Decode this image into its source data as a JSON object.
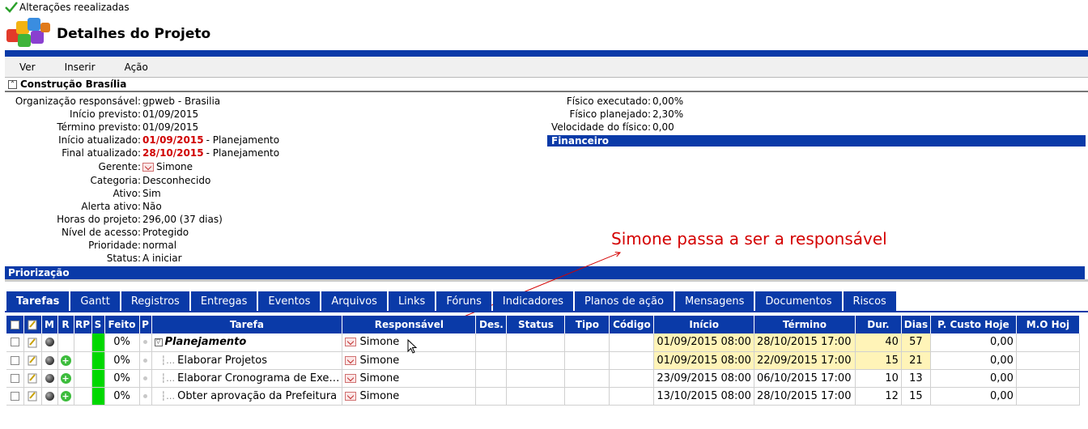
{
  "status": {
    "message": "Alterações reealizadas",
    "icon": "check-icon"
  },
  "header": {
    "title": "Detalhes do Projeto",
    "logo": "puzzle-logo"
  },
  "menu": [
    "Ver",
    "Inserir",
    "Ação"
  ],
  "project": {
    "name": "Construção Brasília",
    "left": [
      {
        "label": "Organização responsável:",
        "value": "gpweb - Brasilia"
      },
      {
        "label": "Início previsto:",
        "value": "01/09/2015"
      },
      {
        "label": "Término previsto:",
        "value": "01/09/2015"
      },
      {
        "label": "Início atualizado:",
        "value": "01/09/2015",
        "suffix": " - Planejamento"
      },
      {
        "label": "Final atualizado:",
        "value": "28/10/2015",
        "suffix": " - Planejamento"
      },
      {
        "label": "Gerente:",
        "value": "Simone"
      },
      {
        "label": "Categoria:",
        "value": "Desconhecido"
      },
      {
        "label": "Ativo:",
        "value": "Sim"
      },
      {
        "label": "Alerta ativo:",
        "value": "Não"
      },
      {
        "label": "Horas do projeto:",
        "value": "296,00 (37 dias)"
      },
      {
        "label": "Nível de acesso:",
        "value": "Protegido"
      },
      {
        "label": "Prioridade:",
        "value": "normal"
      },
      {
        "label": "Status:",
        "value": "A iniciar"
      }
    ],
    "right": [
      {
        "label": "Físico executado:",
        "value": "0,00%"
      },
      {
        "label": "Físico planejado:",
        "value": "2,30%"
      },
      {
        "label": "Velocidade do físico:",
        "value": "0,00"
      }
    ],
    "financeiro": "Financeiro",
    "priorizacao": "Priorização"
  },
  "annotation": "Simone passa a ser a responsável",
  "tabs": [
    "Tarefas",
    "Gantt",
    "Registros",
    "Entregas",
    "Eventos",
    "Arquivos",
    "Links",
    "Fóruns",
    "Indicadores",
    "Planos de ação",
    "Mensagens",
    "Documentos",
    "Riscos"
  ],
  "table": {
    "headers": [
      "",
      "",
      "M",
      "R",
      "RP",
      "S",
      "Feito",
      "P",
      "Tarefa",
      "Responsável",
      "Des.",
      "Status",
      "Tipo",
      "Código",
      "Início",
      "Término",
      "Dur.",
      "Dias",
      "P. Custo Hoje",
      "M.O Hoj"
    ],
    "rows": [
      {
        "feito": "0%",
        "tarefa": "Planejamento",
        "responsavel": "Simone",
        "inicio": "01/09/2015 08:00",
        "termino": "28/10/2015 17:00",
        "dur": "40",
        "dias": "57",
        "custo": "0,00",
        "parent": true,
        "highlight": true
      },
      {
        "feito": "0%",
        "tarefa": "Elaborar Projetos",
        "responsavel": "Simone",
        "inicio": "01/09/2015 08:00",
        "termino": "22/09/2015 17:00",
        "dur": "15",
        "dias": "21",
        "custo": "0,00",
        "parent": false,
        "highlight": true
      },
      {
        "feito": "0%",
        "tarefa": "Elaborar Cronograma de Exe…",
        "responsavel": "Simone",
        "inicio": "23/09/2015 08:00",
        "termino": "06/10/2015 17:00",
        "dur": "10",
        "dias": "13",
        "custo": "0,00",
        "parent": false,
        "highlight": false
      },
      {
        "feito": "0%",
        "tarefa": "Obter aprovação da Prefeitura",
        "responsavel": "Simone",
        "inicio": "13/10/2015 08:00",
        "termino": "28/10/2015 17:00",
        "dur": "12",
        "dias": "15",
        "custo": "0,00",
        "parent": false,
        "highlight": false
      }
    ]
  },
  "colors": {
    "brand_blue": "#0a3aa8",
    "annotation_red": "#d40000",
    "status_green": "#00d800",
    "date_highlight": "#fff4b8"
  }
}
